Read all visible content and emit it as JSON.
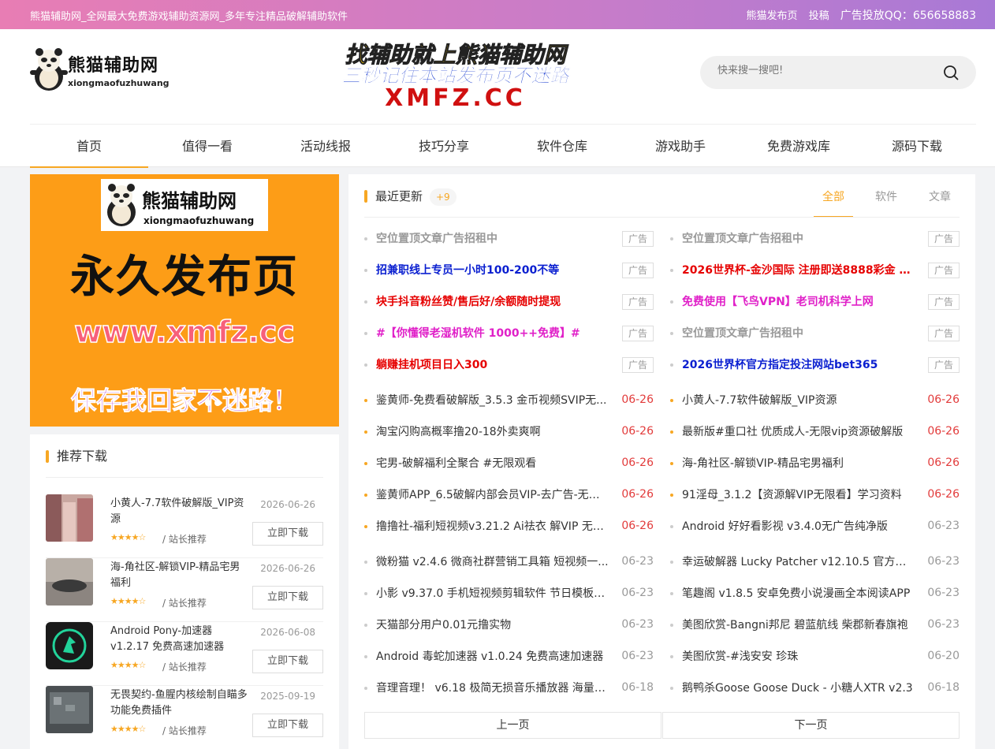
{
  "topbar": {
    "site_desc": "熊猫辅助网_全网最大免费游戏辅助资源网_多年专注精品破解辅助软件",
    "link_publish": "熊猫发布页",
    "link_submit": "投稿",
    "ad_qq": "广告投放QQ：656658883"
  },
  "logo": {
    "cn": "熊猫辅助网",
    "en": "xiongmaofuzhuwang"
  },
  "banner": {
    "line1": "找辅助就上熊猫辅助网",
    "line2": "三秒记住本站发布页不迷路",
    "line3": "XMFZ.CC"
  },
  "search": {
    "placeholder": "快来搜一搜吧!"
  },
  "nav": [
    "首页",
    "值得一看",
    "活动线报",
    "技巧分享",
    "软件仓库",
    "游戏助手",
    "免费游戏库",
    "源码下载"
  ],
  "poster": {
    "logo_cn": "熊猫辅助网",
    "logo_en": "xiongmaofuzhuwang",
    "big": "永久发布页",
    "url": "www.xmfz.cc",
    "slogan": "保存我回家不迷路！"
  },
  "recommend": {
    "title": "推荐下载",
    "items": [
      {
        "name": "小黄人-7.7软件破解版_VIP资源",
        "date": "2026-06-26",
        "rating": 4,
        "author": "/ 站长推荐",
        "button": "立即下载"
      },
      {
        "name": "海-角社区-解锁VIP-精品宅男福利",
        "date": "2026-06-26",
        "rating": 4,
        "author": "/ 站长推荐",
        "button": "立即下载"
      },
      {
        "name": "Android Pony-加速器 v1.2.17 免费高速加速器",
        "date": "2026-06-08",
        "rating": 4,
        "author": "/ 站长推荐",
        "button": "立即下载"
      },
      {
        "name": "无畏契约-鱼腥内核绘制自瞄多功能免费插件",
        "date": "2025-09-19",
        "rating": 4,
        "author": "/ 站长推荐",
        "button": "立即下载"
      }
    ]
  },
  "main": {
    "title": "最近更新",
    "badge": "+9",
    "tabs": [
      "全部",
      "软件",
      "文章"
    ],
    "ad_label": "广告",
    "colors": {
      "accent": "#f7a723",
      "red": "#e60000",
      "blue": "#0a1fd0",
      "magenta": "#e020c8",
      "gray": "#999999"
    },
    "ads_left": [
      {
        "text": "空位置顶文章广告招租中",
        "color": "#999999"
      },
      {
        "text": "招兼职线上专员一小时100-200不等",
        "color": "#0a1fd0"
      },
      {
        "text": "块手抖音粉丝赞/售后好/余额随时提现",
        "color": "#e60000"
      },
      {
        "text": "#【你懂得老湿机软件 1000++免费】#",
        "color": "#e020c8"
      },
      {
        "text": "躺赚挂机项目日入300",
        "color": "#e60000"
      }
    ],
    "ads_right": [
      {
        "text": "空位置顶文章广告招租中",
        "color": "#999999"
      },
      {
        "text": "2026世界杯-金沙国际 注册即送8888彩金 十...",
        "color": "#e60000"
      },
      {
        "text": "免费使用【飞鸟VPN】老司机科学上网",
        "color": "#e020c8"
      },
      {
        "text": "空位置顶文章广告招租中",
        "color": "#999999"
      },
      {
        "text": "2026世界杯官方指定投注网站bet365",
        "color": "#0a1fd0"
      }
    ],
    "posts_left": [
      {
        "title": "鉴黄师-免费看破解版_3.5.3 金币视频SVIP无...",
        "date": "06-26",
        "new": true
      },
      {
        "title": "淘宝闪购高概率撸20-18外卖爽啊",
        "date": "06-26",
        "new": true
      },
      {
        "title": "宅男-破解福利全聚合 #无限观看",
        "date": "06-26",
        "new": true
      },
      {
        "title": "鉴黄师APP_6.5破解内部会员VIP-去广告-无限...",
        "date": "06-26",
        "new": true
      },
      {
        "title": "撸撸社-福利短视频v3.21.2 Ai祛衣 解VIP 无限...",
        "date": "06-26",
        "new": true
      },
      {
        "title": "微粉猫 v2.4.6 微商社群营销工具箱 短视频一...",
        "date": "06-23",
        "new": false
      },
      {
        "title": "小影 v9.37.0 手机短视频剪辑软件 节日模板一...",
        "date": "06-23",
        "new": false
      },
      {
        "title": "天猫部分用户0.01元撸实物",
        "date": "06-23",
        "new": false
      },
      {
        "title": "Android 毒蛇加速器 v1.0.24 免费高速加速器",
        "date": "06-23",
        "new": false
      },
      {
        "title": "音理音理！ v6.18 极简无损音乐播放器 海量精...",
        "date": "06-18",
        "new": false
      }
    ],
    "posts_right": [
      {
        "title": "小黄人-7.7软件破解版_VIP资源",
        "date": "06-26",
        "new": true
      },
      {
        "title": "最新版#重口社 优质成人-无限vip资源破解版",
        "date": "06-26",
        "new": true
      },
      {
        "title": "海-角社区-解锁VIP-精品宅男福利",
        "date": "06-26",
        "new": true
      },
      {
        "title": "91淫母_3.1.2【资源解VIP无限看】学习资料",
        "date": "06-26",
        "new": true
      },
      {
        "title": "Android 好好看影视 v3.4.0无广告纯净版",
        "date": "06-23",
        "new": false
      },
      {
        "title": "幸运破解器 Lucky Patcher v12.10.5 官方最新...",
        "date": "06-23",
        "new": false
      },
      {
        "title": "笔趣阁 v1.8.5 安卓免费小说漫画全本阅读APP",
        "date": "06-23",
        "new": false
      },
      {
        "title": "美图欣赏-Bangni邦尼 碧蓝航线 柴郡新春旗袍",
        "date": "06-23",
        "new": false
      },
      {
        "title": "美图欣赏-#浅安安 珍珠",
        "date": "06-20",
        "new": false
      },
      {
        "title": "鹅鸭杀Goose Goose Duck - 小糖人XTR v2.3",
        "date": "06-18",
        "new": false
      }
    ],
    "prev": "上一页",
    "next": "下一页"
  }
}
